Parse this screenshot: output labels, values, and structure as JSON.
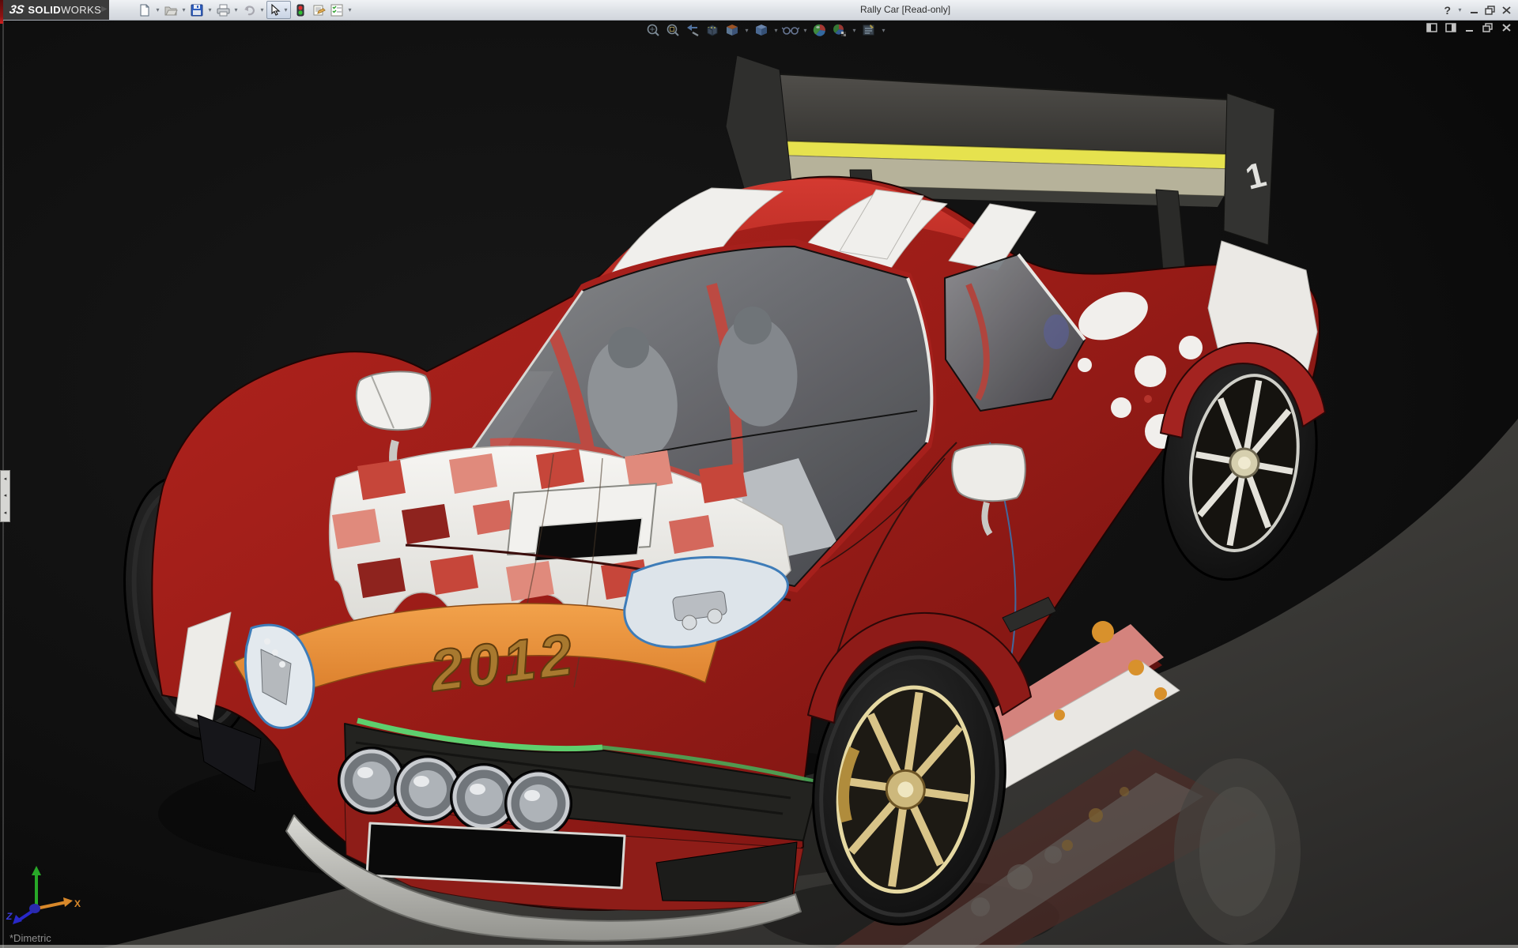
{
  "window": {
    "logo": {
      "mark": "3S",
      "brand_bold": "SOLID",
      "brand_light": "WORKS"
    },
    "title": "Rally Car [Read-only]",
    "help_glyph": "?",
    "toolbar_icons": [
      "new-document",
      "open",
      "save",
      "print",
      "undo",
      "select",
      "rebuild-traffic-light",
      "file-properties",
      "options"
    ],
    "window_controls": [
      "help",
      "minimize",
      "restore",
      "close"
    ]
  },
  "headsup_toolbar": {
    "icons": [
      "zoom-to-fit",
      "zoom-to-area",
      "previous-view",
      "section-view",
      "view-orientation",
      "display-style",
      "hide-show-items",
      "edit-appearance",
      "apply-scene",
      "view-settings"
    ]
  },
  "document_controls": [
    "show-left-pane",
    "show-right-pane",
    "minimize-document",
    "restore-document",
    "close-document"
  ],
  "viewport": {
    "orientation_label": "*Dimetric",
    "collapse_glyph": "◂",
    "triad": {
      "x_label": "X",
      "z_label": "Z"
    },
    "car": {
      "year_decal": "2012",
      "wing_number": "1"
    }
  },
  "colors": {
    "titlebar": "#dde1e6",
    "logo_bg": "#3b3b3b",
    "viewport_bg": "#0c0c0c",
    "floor_gray": "#45443f",
    "body_red": "#a01d18",
    "roof_red": "#c92f28",
    "stripe_white": "#f0efec",
    "decal_orange": "#e8893b",
    "decal_year_gold": "#a8792f",
    "wing_gray": "#4a4a46",
    "wing_yellow": "#e6e24e",
    "accent_green": "#5ecf6e",
    "rim_gold": "#c9a85c",
    "rim_chrome": "#d9d8d2",
    "glass_gray": "#70767c",
    "headlight_edge_blue": "#3e7cb8"
  }
}
